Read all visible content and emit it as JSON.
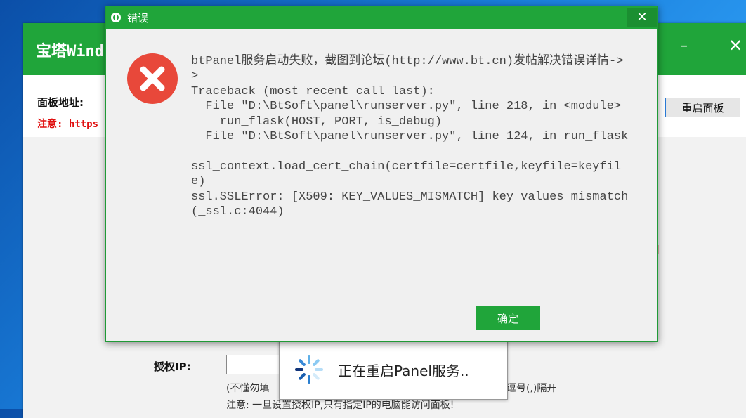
{
  "main_window": {
    "title": "宝塔Windows",
    "minimize_glyph": "–",
    "close_glyph": "✕",
    "panel_address_label": "面板地址:",
    "notice_https": "注意: https",
    "restart_button_label": "重启面板",
    "red_fragment": "]",
    "auth_ip_label": "授权IP:",
    "auth_ip_value": "",
    "hint_left": "(不懂勿填",
    "hint_right": "逗号(,)隔开",
    "auth_ip_notice": "注意: 一旦设置授权IP,只有指定IP的电脑能访问面板!"
  },
  "loading_toast": {
    "text": "正在重启Panel服务..",
    "icon": "spinner-icon"
  },
  "error_dialog": {
    "title": "错误",
    "close_glyph": "✕",
    "icon": "error-x-icon",
    "message": "btPanel服务启动失败，截图到论坛(http://www.bt.cn)发帖解决错误详情->>\nTraceback (most recent call last):\n  File \"D:\\BtSoft\\panel\\runserver.py\", line 218, in <module>\n    run_flask(HOST, PORT, is_debug)\n  File \"D:\\BtSoft\\panel\\runserver.py\", line 124, in run_flask\n\nssl_context.load_cert_chain(certfile=certfile,keyfile=keyfile)\nssl.SSLError: [X509: KEY_VALUES_MISMATCH] key values mismatch (_ssl.c:4044)",
    "ok_label": "确定"
  },
  "colors": {
    "brand_green": "#20a53a",
    "error_red": "#e8483a",
    "notice_red": "#e01010"
  }
}
